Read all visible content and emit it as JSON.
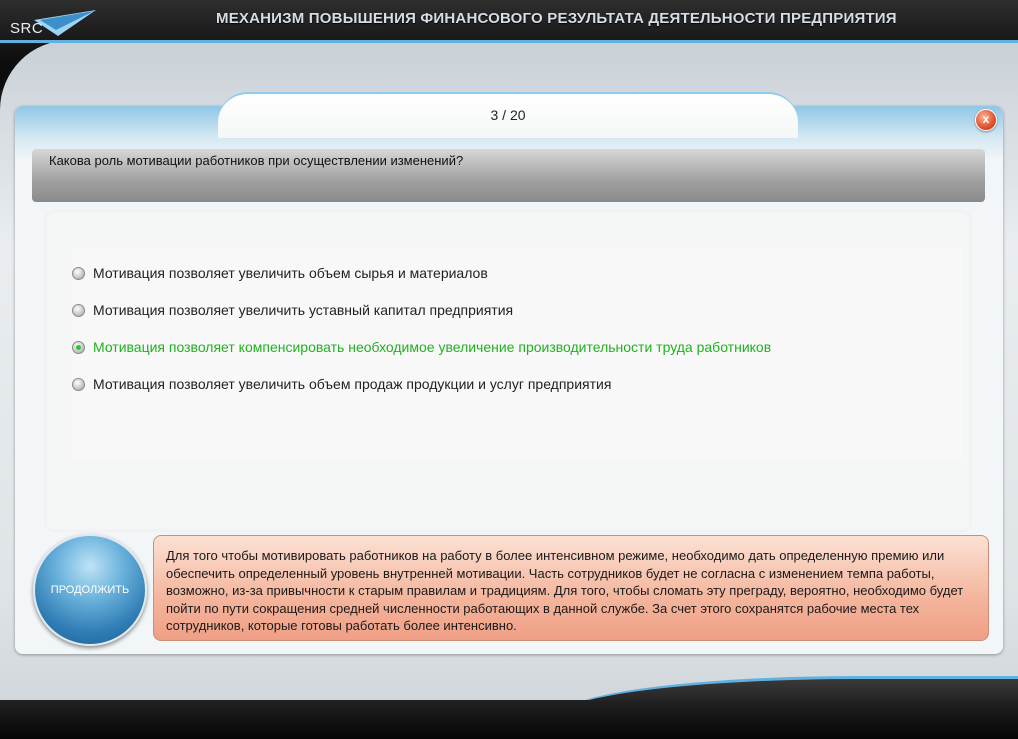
{
  "app": {
    "logo_text": "SRC",
    "title": "МЕХАНИЗМ ПОВЫШЕНИЯ ФИНАНСОВОГО РЕЗУЛЬТАТА ДЕЯТЕЛЬНОСТИ ПРЕДПРИЯТИЯ"
  },
  "quiz": {
    "counter": "3 / 20",
    "close_symbol": "x",
    "question": "Какова роль мотивации работников при осуществлении изменений?",
    "answers": [
      {
        "label": "Мотивация позволяет увеличить объем сырья и материалов",
        "selected": false
      },
      {
        "label": "Мотивация позволяет увеличить уставный капитал предприятия",
        "selected": false
      },
      {
        "label": "Мотивация позволяет компенсировать необходимое увеличение производительности труда работников",
        "selected": true
      },
      {
        "label": "Мотивация позволяет увеличить объем продаж продукции и услуг предприятия",
        "selected": false
      }
    ],
    "continue_label": "ПРОДОЛЖИТЬ",
    "feedback": "Для того чтобы мотивировать работников на работу в более интенсивном режиме, необходимо дать определенную премию или обеспечить определенный уровень внутренней мотивации. Часть сотрудников будет не согласна с изменением темпа работы, возможно, из-за привычности к старым правилам и традициям. Для того, чтобы сломать эту преграду, вероятно, необходимо будет пойти по пути сокращения средней численности работающих в данной службе. За счет этого сохранятся рабочие места тех сотрудников, которые готовы работать более интенсивно."
  },
  "colors": {
    "accent_blue": "#5fb2e0",
    "selected_green": "#22b022",
    "feedback_bg": "#f4b59c"
  },
  "icons": {
    "logo": "src-logo-icon",
    "close": "close-icon",
    "radio": "radio-icon"
  }
}
